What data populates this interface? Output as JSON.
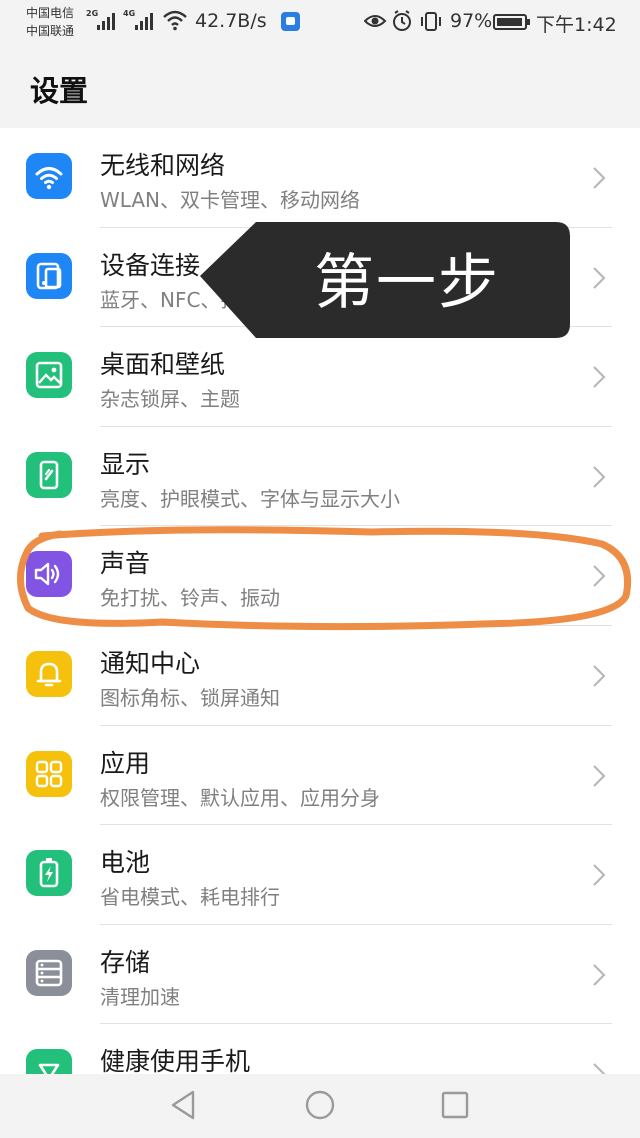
{
  "status_bar": {
    "carrier_1": "中国电信",
    "carrier_2": "中国联通",
    "sim1_tag": "2G",
    "sim2_tag": "4G",
    "net_speed": "42.7B/s",
    "battery_pct": "97%",
    "time": "下午1:42"
  },
  "header": {
    "title": "设置"
  },
  "settings": [
    {
      "title": "无线和网络",
      "subtitle": "WLAN、双卡管理、移动网络",
      "icon": "wifi-icon",
      "color": "#1f86f6"
    },
    {
      "title": "设备连接",
      "subtitle": "蓝牙、NFC、打印",
      "icon": "device-connect-icon",
      "color": "#1f86f6"
    },
    {
      "title": "桌面和壁纸",
      "subtitle": "杂志锁屏、主题",
      "icon": "wallpaper-icon",
      "color": "#22c07a"
    },
    {
      "title": "显示",
      "subtitle": "亮度、护眼模式、字体与显示大小",
      "icon": "display-icon",
      "color": "#22c07a"
    },
    {
      "title": "声音",
      "subtitle": "免打扰、铃声、振动",
      "icon": "sound-icon",
      "color": "#8254e4"
    },
    {
      "title": "通知中心",
      "subtitle": "图标角标、锁屏通知",
      "icon": "bell-icon",
      "color": "#f5c10c"
    },
    {
      "title": "应用",
      "subtitle": "权限管理、默认应用、应用分身",
      "icon": "apps-icon",
      "color": "#f5c10c"
    },
    {
      "title": "电池",
      "subtitle": "省电模式、耗电排行",
      "icon": "battery-icon",
      "color": "#22c07a"
    },
    {
      "title": "存储",
      "subtitle": "清理加速",
      "icon": "storage-icon",
      "color": "#8a8f99"
    },
    {
      "title": "健康使用手机",
      "subtitle": "",
      "icon": "health-icon",
      "color": "#22c07a"
    }
  ],
  "annotation": {
    "callout_text": "第一步",
    "callout_color": "#2b2b2b",
    "highlight_color": "#ee8d45"
  }
}
